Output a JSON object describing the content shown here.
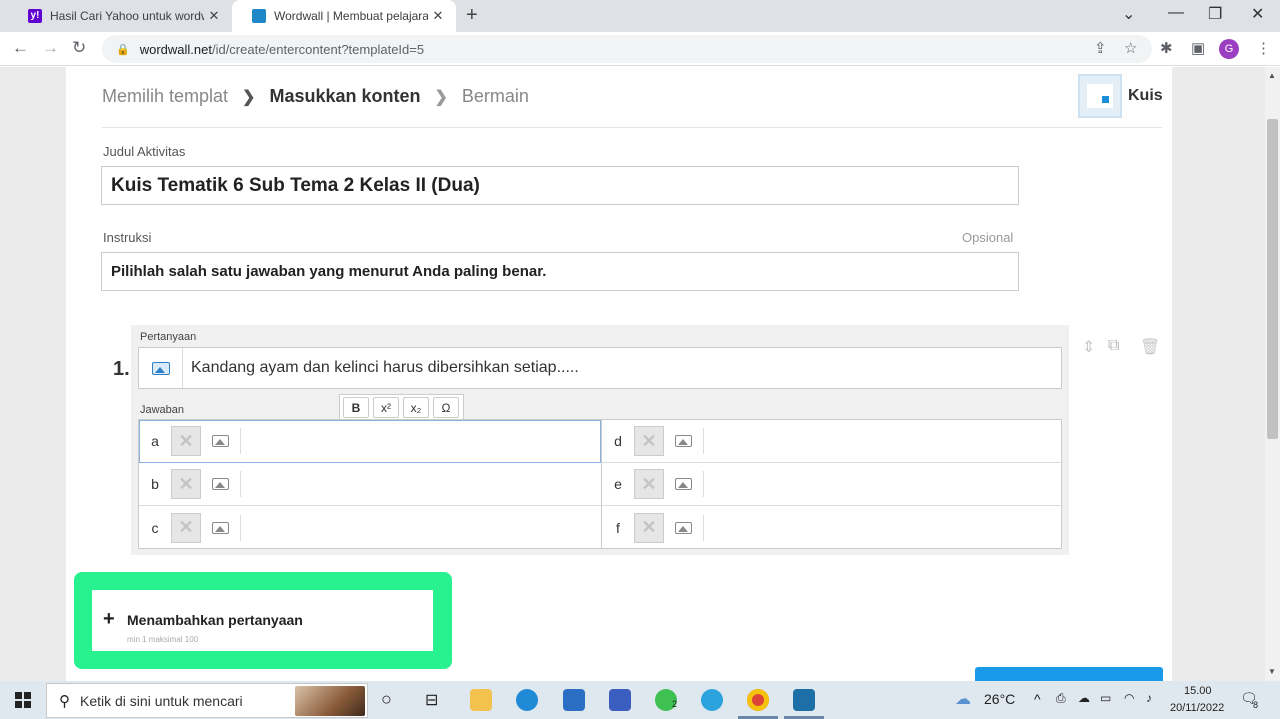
{
  "browser": {
    "tabs": [
      {
        "title": "Hasil Cari Yahoo untuk wordwall",
        "favicon_color": "#6001d2",
        "active": false
      },
      {
        "title": "Wordwall | Membuat pelajaran y",
        "favicon_color": "#1e88c8",
        "active": true
      }
    ],
    "url_host": "wordwall.net",
    "url_path": "/id/create/entercontent?templateId=5",
    "profile_initial": "G"
  },
  "breadcrumb": {
    "step1": "Memilih templat",
    "step2": "Masukkan konten",
    "step3": "Bermain"
  },
  "template": {
    "name": "Kuis"
  },
  "activity": {
    "title_label": "Judul Aktivitas",
    "title_value": "Kuis Tematik 6 Sub Tema 2 Kelas II (Dua)",
    "instruction_label": "Instruksi",
    "instruction_optional": "Opsional",
    "instruction_value": "Pilihlah salah satu jawaban yang menurut Anda paling benar."
  },
  "question": {
    "number": "1.",
    "label": "Pertanyaan",
    "text": "Kandang ayam dan kelinci harus dibersihkan setiap.....",
    "answers_label": "Jawaban",
    "format_buttons": [
      "B",
      "x²",
      "x₂",
      "Ω"
    ],
    "answers": [
      {
        "letter": "a",
        "value": ""
      },
      {
        "letter": "b",
        "value": ""
      },
      {
        "letter": "c",
        "value": ""
      },
      {
        "letter": "d",
        "value": ""
      },
      {
        "letter": "e",
        "value": ""
      },
      {
        "letter": "f",
        "value": ""
      }
    ]
  },
  "add_question": {
    "label": "Menambahkan pertanyaan",
    "limits": "min 1   maksimal 100"
  },
  "taskbar": {
    "search_placeholder": "Ketik di sini untuk mencari",
    "weather": "26°C",
    "time": "15.00",
    "date": "20/11/2022",
    "notification_count": "8",
    "whatsapp_badge": "2"
  },
  "colors": {
    "highlight": "#27f28f",
    "primary_button": "#1a9bea"
  }
}
